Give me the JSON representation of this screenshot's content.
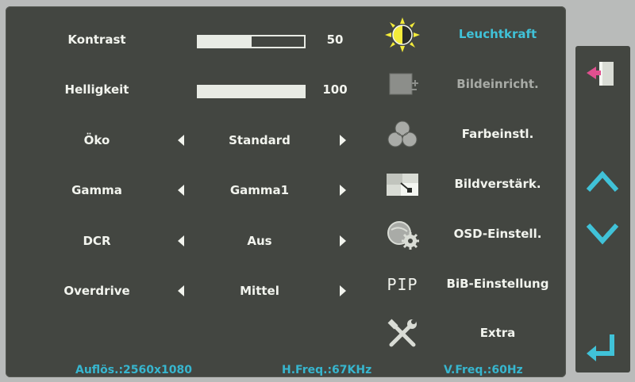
{
  "settings": [
    {
      "label": "Kontrast",
      "type": "bar",
      "value": "50",
      "level": 0.5
    },
    {
      "label": "Helligkeit",
      "type": "bar",
      "value": "100",
      "level": 1.0
    },
    {
      "label": "Öko",
      "type": "select",
      "value": "Standard"
    },
    {
      "label": "Gamma",
      "type": "select",
      "value": "Gamma1"
    },
    {
      "label": "DCR",
      "type": "select",
      "value": "Aus"
    },
    {
      "label": "Overdrive",
      "type": "select",
      "value": "Mittel"
    }
  ],
  "menu": [
    {
      "label": "Leuchtkraft",
      "icon": "brightness-sun-icon",
      "state": "active"
    },
    {
      "label": "Bildeinricht.",
      "icon": "image-setup-icon",
      "state": "disabled"
    },
    {
      "label": "Farbeinstl.",
      "icon": "color-settings-icon",
      "state": "normal"
    },
    {
      "label": "Bildverstärk.",
      "icon": "picture-boost-icon",
      "state": "normal"
    },
    {
      "label": "OSD-Einstell.",
      "icon": "osd-settings-icon",
      "state": "normal"
    },
    {
      "label": "BiB-Einstellung",
      "icon": "pip-icon",
      "icon_text": "PIP",
      "state": "normal"
    },
    {
      "label": "Extra",
      "icon": "tools-icon",
      "state": "normal"
    }
  ],
  "footer": {
    "resolution": "Auflös.:2560x1080",
    "hfreq": "H.Freq.:67KHz",
    "vfreq": "V.Freq.:60Hz"
  },
  "side_buttons": [
    "exit-icon",
    "up-arrow-icon",
    "down-arrow-icon",
    "enter-icon"
  ],
  "colors": {
    "panel": "#434641",
    "text": "#f2f4ee",
    "accent": "#40c2d8",
    "sun": "#f4ec3a"
  }
}
